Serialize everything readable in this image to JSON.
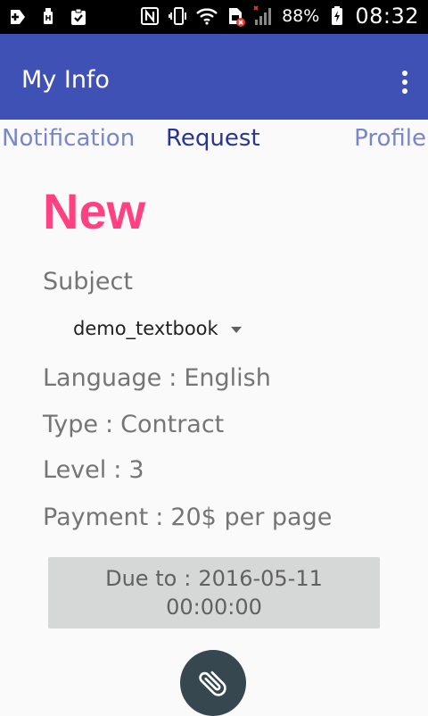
{
  "status_bar": {
    "battery_text": "88%",
    "time": "08:32",
    "icons_left": [
      "add-icon",
      "usb-icon",
      "clipboard-check-icon"
    ],
    "icons_right": [
      "nfc-icon",
      "vibrate-icon",
      "wifi-icon",
      "sim-error-icon",
      "signal-icon",
      "battery-charging-icon"
    ]
  },
  "app_bar": {
    "title": "My Info",
    "menu_icon": "more-vert-icon"
  },
  "tabs": [
    {
      "label": "Notification",
      "active": false
    },
    {
      "label": "Request",
      "active": true
    },
    {
      "label": "Profile",
      "active": false
    }
  ],
  "request": {
    "status": "New",
    "subject_label": "Subject",
    "subject_value": "demo_textbook",
    "language_label": "Language",
    "language_value": "English",
    "type_label": "Type",
    "type_value": "Contract",
    "level_label": "Level",
    "level_value": "3",
    "payment_label": "Payment",
    "payment_value": "20$ per page",
    "separator": ":",
    "due_label": "Due to",
    "due_date": "2016-05-11",
    "due_time": "00:00:00"
  },
  "fab": {
    "icon": "attachment-icon"
  },
  "colors": {
    "status_bar": "#000000",
    "app_bar": "#3f51b5",
    "tab_active": "#283593",
    "tab_inactive": "#7986cb",
    "status_new": "#ff4081",
    "due_box": "#d6d7d7",
    "fab": "#37474f"
  }
}
